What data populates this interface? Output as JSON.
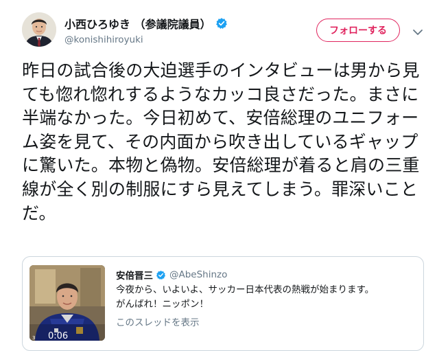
{
  "tweet": {
    "author_name": "小西ひろゆき （参議院議員）",
    "handle": "@konishihiroyuki",
    "follow_label": "フォローする",
    "text": "昨日の試合後の大迫選手のインタビューは男から見ても惚れ惚れするようなカッコ良さだった。まさに半端なかった。今日初めて、安倍総理のユニフォーム姿を見て、その内面から吹き出しているギャップに驚いた。本物と偽物。安倍総理が着ると肩の三重線が全く別の制服にすら見えてしまう。罪深いことだ。"
  },
  "quoted": {
    "author_name": "安倍晋三",
    "handle": "@AbeShinzo",
    "text_line1": "今夜から、いよいよ、サッカー日本代表の熱戦が始まります。",
    "text_line2": "がんばれ！ニッポン！",
    "thread_link": "このスレッドを表示",
    "video_time": "0:06",
    "media_mark": "3"
  },
  "colors": {
    "accent": "#e0245e",
    "verified": "#1da1f2",
    "secondary_text": "#657786",
    "border": "#ccd6dd"
  },
  "icons": {
    "verified": "verified-badge-icon",
    "caret": "chevron-down-icon"
  }
}
